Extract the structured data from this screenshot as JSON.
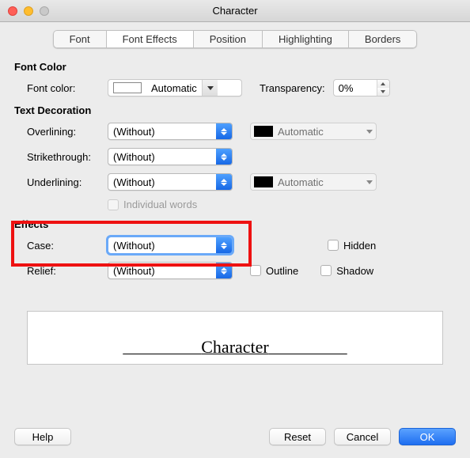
{
  "window": {
    "title": "Character"
  },
  "tabs": [
    "Font",
    "Font Effects",
    "Position",
    "Highlighting",
    "Borders"
  ],
  "active_tab": "Font Effects",
  "sections": {
    "font_color": {
      "title": "Font Color",
      "font_color_label": "Font color:",
      "font_color_value": "Automatic",
      "transparency_label": "Transparency:",
      "transparency_value": "0%"
    },
    "text_decoration": {
      "title": "Text Decoration",
      "overlining_label": "Overlining:",
      "overlining_value": "(Without)",
      "overlining_color": "Automatic",
      "strike_label": "Strikethrough:",
      "strike_value": "(Without)",
      "underlining_label": "Underlining:",
      "underlining_value": "(Without)",
      "underlining_color": "Automatic",
      "individual_words_label": "Individual words"
    },
    "effects": {
      "title": "Effects",
      "case_label": "Case:",
      "case_value": "(Without)",
      "hidden_label": "Hidden",
      "relief_label": "Relief:",
      "relief_value": "(Without)",
      "outline_label": "Outline",
      "shadow_label": "Shadow"
    }
  },
  "preview": {
    "text": "Character"
  },
  "footer": {
    "help": "Help",
    "reset": "Reset",
    "cancel": "Cancel",
    "ok": "OK"
  },
  "highlight": {
    "section": "effects.case"
  }
}
